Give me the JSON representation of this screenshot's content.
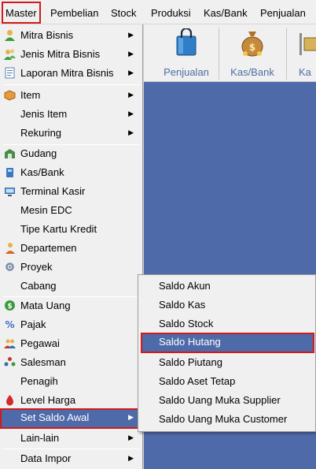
{
  "menubar": {
    "items": [
      {
        "label": "Master"
      },
      {
        "label": "Pembelian"
      },
      {
        "label": "Stock"
      },
      {
        "label": "Produksi"
      },
      {
        "label": "Kas/Bank"
      },
      {
        "label": "Penjualan"
      }
    ]
  },
  "toolbar": {
    "buttons": [
      {
        "label": "Penjualan",
        "icon": "shopping-bag-icon"
      },
      {
        "label": "Kas/Bank",
        "icon": "money-bag-icon"
      },
      {
        "label": "Ka",
        "icon": "cart-icon"
      }
    ]
  },
  "master_menu": {
    "items": [
      {
        "label": "Mitra Bisnis",
        "icon": "person-icon",
        "submenu": true
      },
      {
        "label": "Jenis Mitra Bisnis",
        "icon": "people-icon",
        "submenu": true
      },
      {
        "label": "Laporan Mitra Bisnis",
        "icon": "report-icon",
        "submenu": true
      },
      {
        "label": "Item",
        "icon": "item-icon",
        "submenu": true
      },
      {
        "label": "Jenis Item",
        "submenu": true
      },
      {
        "label": "Rekuring",
        "submenu": true
      },
      {
        "label": "Gudang",
        "icon": "warehouse-icon"
      },
      {
        "label": "Kas/Bank",
        "icon": "cash-icon"
      },
      {
        "label": "Terminal Kasir",
        "icon": "terminal-icon"
      },
      {
        "label": "Mesin EDC"
      },
      {
        "label": "Tipe Kartu Kredit"
      },
      {
        "label": "Departemen",
        "icon": "department-icon"
      },
      {
        "label": "Proyek",
        "icon": "project-icon"
      },
      {
        "label": "Cabang"
      },
      {
        "label": "Mata Uang",
        "icon": "currency-icon"
      },
      {
        "label": "Pajak",
        "icon": "tax-icon"
      },
      {
        "label": "Pegawai",
        "icon": "employee-icon"
      },
      {
        "label": "Salesman",
        "icon": "salesman-icon"
      },
      {
        "label": "Penagih"
      },
      {
        "label": "Level Harga",
        "icon": "price-level-icon"
      },
      {
        "label": "Set Saldo Awal",
        "submenu": true,
        "selected": true
      },
      {
        "label": "Lain-lain",
        "submenu": true
      },
      {
        "label": "Data Impor",
        "submenu": true
      }
    ]
  },
  "saldo_submenu": {
    "items": [
      {
        "label": "Saldo Akun"
      },
      {
        "label": "Saldo Kas"
      },
      {
        "label": "Saldo Stock"
      },
      {
        "label": "Saldo Hutang",
        "selected": true
      },
      {
        "label": "Saldo Piutang"
      },
      {
        "label": "Saldo Aset Tetap"
      },
      {
        "label": "Saldo Uang Muka Supplier"
      },
      {
        "label": "Saldo Uang Muka Customer"
      }
    ]
  },
  "colors": {
    "highlight": "#4f6aa8",
    "annotation_border": "#d11a1a",
    "workspace": "#4f6aa8"
  }
}
